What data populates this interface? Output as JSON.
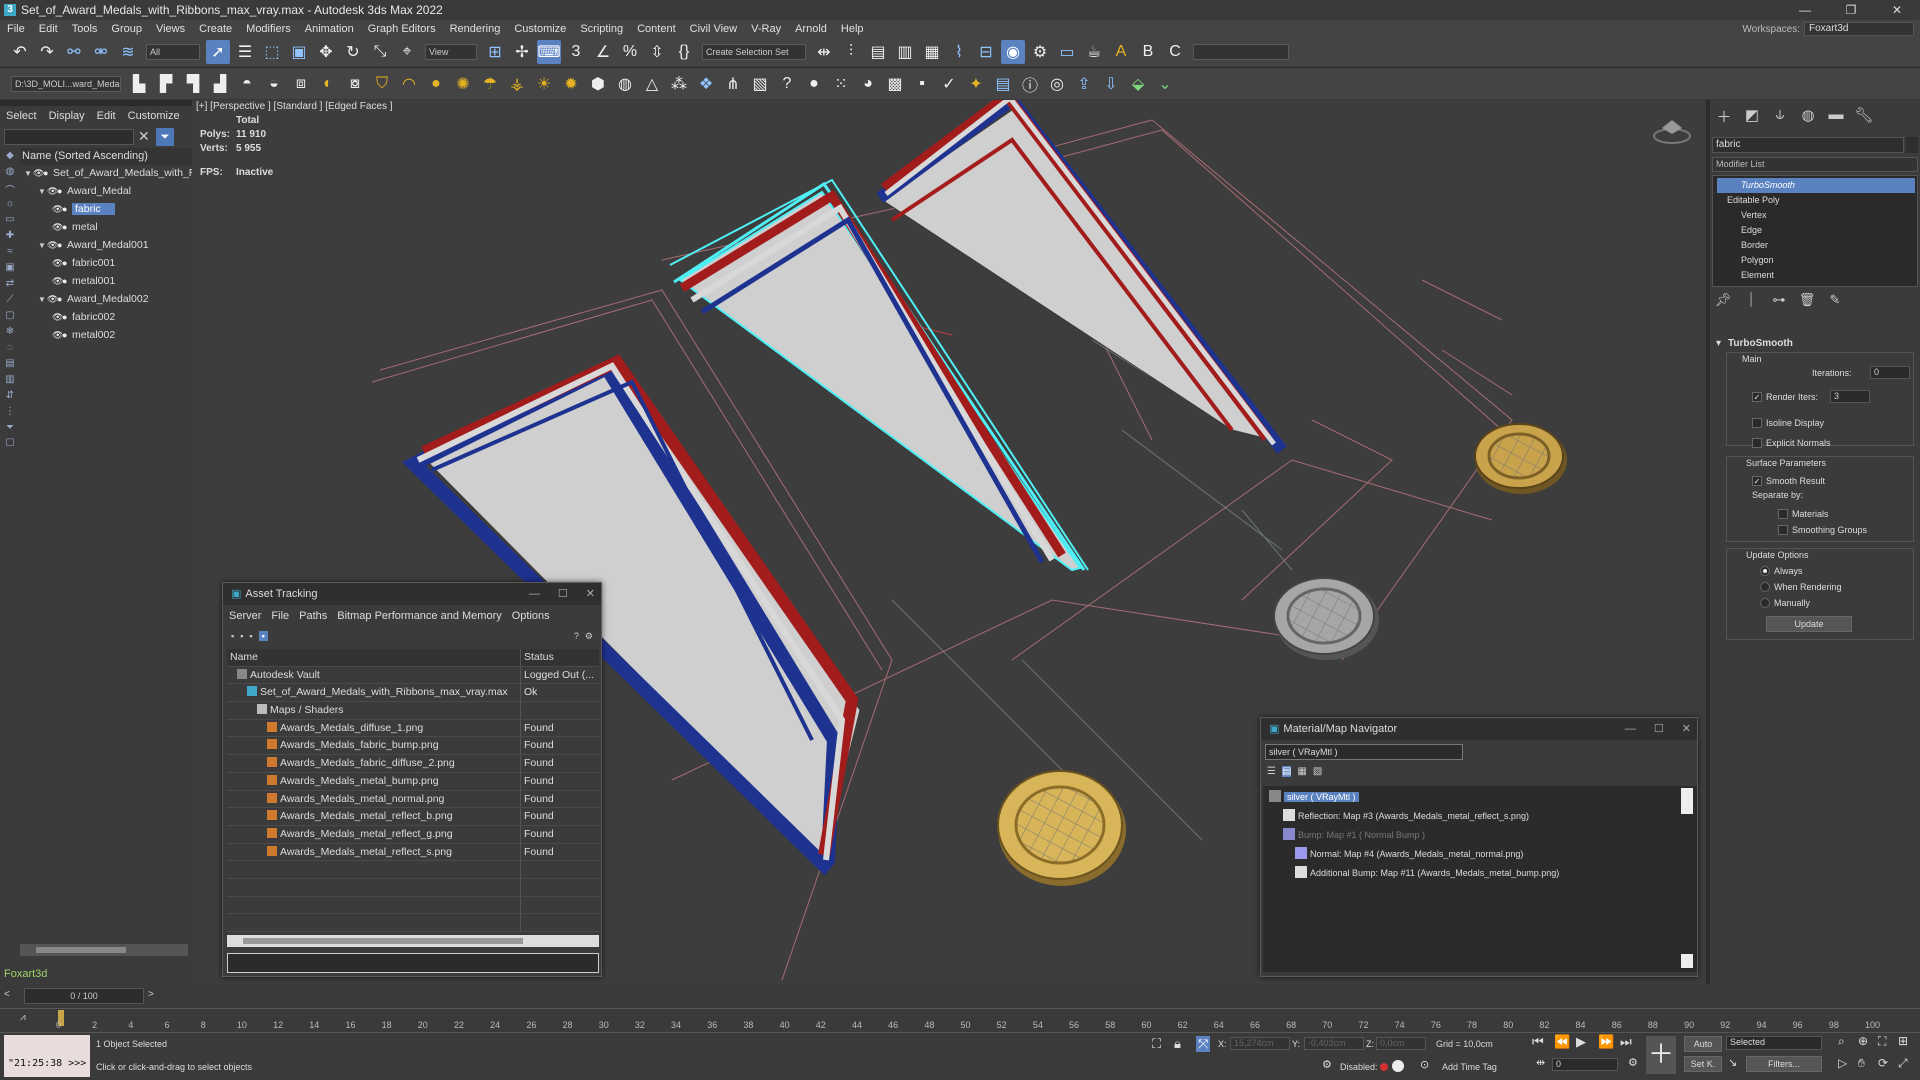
{
  "window": {
    "title": "Set_of_Award_Medals_with_Ribbons_max_vray.max - Autodesk 3ds Max 2022",
    "workspaces_label": "Workspaces:",
    "workspace_value": "Foxart3d"
  },
  "menu": [
    "File",
    "Edit",
    "Tools",
    "Group",
    "Views",
    "Create",
    "Modifiers",
    "Animation",
    "Graph Editors",
    "Rendering",
    "Customize",
    "Scripting",
    "Content",
    "Civil View",
    "V-Ray",
    "Arnold",
    "Help"
  ],
  "toolbar": {
    "selection_filter": "All",
    "ref_coord": "View",
    "named_selection": "Create Selection Set",
    "project_path": "D:\\3D_MOLI...ward_Meda"
  },
  "scene_explorer": {
    "tabs": [
      "Select",
      "Display",
      "Edit",
      "Customize"
    ],
    "header": "Name (Sorted Ascending)",
    "items": [
      {
        "label": "Set_of_Award_Medals_with_Ri",
        "depth": 0
      },
      {
        "label": "Award_Medal",
        "depth": 1
      },
      {
        "label": "fabric",
        "depth": 2,
        "selected": true
      },
      {
        "label": "metal",
        "depth": 2
      },
      {
        "label": "Award_Medal001",
        "depth": 1
      },
      {
        "label": "fabric001",
        "depth": 2
      },
      {
        "label": "metal001",
        "depth": 2
      },
      {
        "label": "Award_Medal002",
        "depth": 1
      },
      {
        "label": "fabric002",
        "depth": 2
      },
      {
        "label": "metal002",
        "depth": 2
      }
    ],
    "user": "Foxart3d"
  },
  "viewport": {
    "label": "[+] [Perspective ] [Standard ] [Edged Faces ]",
    "stats_title": "Total",
    "polys_label": "Polys:",
    "polys": "11 910",
    "verts_label": "Verts:",
    "verts": "5 955",
    "fps_label": "FPS:",
    "fps": "Inactive"
  },
  "command_panel": {
    "object_name": "fabric",
    "modifier_list": "Modifier List",
    "stack": [
      {
        "label": "TurboSmooth",
        "selected": true
      },
      {
        "label": "Editable Poly"
      },
      {
        "label": "Vertex"
      },
      {
        "label": "Edge"
      },
      {
        "label": "Border"
      },
      {
        "label": "Polygon"
      },
      {
        "label": "Element"
      }
    ],
    "turbosmooth": {
      "title": "TurboSmooth",
      "main": "Main",
      "iterations_label": "Iterations:",
      "iterations": "0",
      "render_iters_label": "Render Iters:",
      "render_iters": "3",
      "isoline": "Isoline Display",
      "explicit_normals": "Explicit Normals",
      "surface_params": "Surface Parameters",
      "smooth_result": "Smooth Result",
      "separate_by": "Separate by:",
      "materials": "Materials",
      "smoothing_groups": "Smoothing Groups",
      "update_options": "Update Options",
      "always": "Always",
      "when_rendering": "When Rendering",
      "manually": "Manually",
      "update_btn": "Update"
    }
  },
  "asset_tracking": {
    "title": "Asset Tracking",
    "menu": [
      "Server",
      "File",
      "Paths",
      "Bitmap Performance and Memory",
      "Options"
    ],
    "col_name": "Name",
    "col_status": "Status",
    "rows": [
      {
        "name": "Autodesk Vault",
        "status": "Logged Out (...",
        "indent": 1
      },
      {
        "name": "Set_of_Award_Medals_with_Ribbons_max_vray.max",
        "status": "Ok",
        "indent": 2
      },
      {
        "name": "Maps / Shaders",
        "status": "",
        "indent": 3
      },
      {
        "name": "Awards_Medals_diffuse_1.png",
        "status": "Found",
        "indent": 4
      },
      {
        "name": "Awards_Medals_fabric_bump.png",
        "status": "Found",
        "indent": 4
      },
      {
        "name": "Awards_Medals_fabric_diffuse_2.png",
        "status": "Found",
        "indent": 4
      },
      {
        "name": "Awards_Medals_metal_bump.png",
        "status": "Found",
        "indent": 4
      },
      {
        "name": "Awards_Medals_metal_normal.png",
        "status": "Found",
        "indent": 4
      },
      {
        "name": "Awards_Medals_metal_reflect_b.png",
        "status": "Found",
        "indent": 4
      },
      {
        "name": "Awards_Medals_metal_reflect_g.png",
        "status": "Found",
        "indent": 4
      },
      {
        "name": "Awards_Medals_metal_reflect_s.png",
        "status": "Found",
        "indent": 4
      }
    ]
  },
  "material_navigator": {
    "title": "Material/Map Navigator",
    "current": "silver  ( VRayMtl )",
    "items": [
      {
        "label": "silver  ( VRayMtl )",
        "selected": true
      },
      {
        "label": "Reflection: Map #3 (Awards_Medals_metal_reflect_s.png)"
      },
      {
        "label": "Bump: Map #1  ( Normal Bump )",
        "dim": true
      },
      {
        "label": "Normal: Map #4 (Awards_Medals_metal_normal.png)"
      },
      {
        "label": "Additional Bump: Map #11 (Awards_Medals_metal_bump.png)"
      }
    ]
  },
  "timeline": {
    "frame": "0 / 100",
    "ticks": [
      "0",
      "2",
      "4",
      "6",
      "8",
      "10",
      "12",
      "14",
      "16",
      "18",
      "20",
      "22",
      "24",
      "26",
      "28",
      "30",
      "32",
      "34",
      "36",
      "38",
      "40",
      "42",
      "44",
      "46",
      "48",
      "50",
      "52",
      "54",
      "56",
      "58",
      "60",
      "62",
      "64",
      "66",
      "68",
      "70",
      "72",
      "74",
      "76",
      "78",
      "80",
      "82",
      "84",
      "86",
      "88",
      "90",
      "92",
      "94",
      "96",
      "98",
      "100"
    ]
  },
  "status": {
    "maxscript_time": "\"21:25:38 >>>",
    "selected": "1 Object Selected",
    "hint": "Click or click-and-drag to select objects",
    "x_label": "X:",
    "x": "15,274cm",
    "y_label": "Y:",
    "y": "-0,403cm",
    "z_label": "Z:",
    "z": "0,0cm",
    "grid": "Grid = 10,0cm",
    "disabled": "Disabled:",
    "add_time_tag": "Add Time Tag",
    "auto": "Auto",
    "set_k": "Set K.",
    "selected_dd": "Selected",
    "filters": "Filters...",
    "frame_value": "0"
  },
  "colors": {
    "accent": "#5b82c0",
    "ribbon_red": "#a31c1c",
    "ribbon_blue": "#1e3290",
    "ribbon_white": "#d8d8d8",
    "gold": "#d9b55a",
    "selection_cyan": "#4ff0f5"
  }
}
